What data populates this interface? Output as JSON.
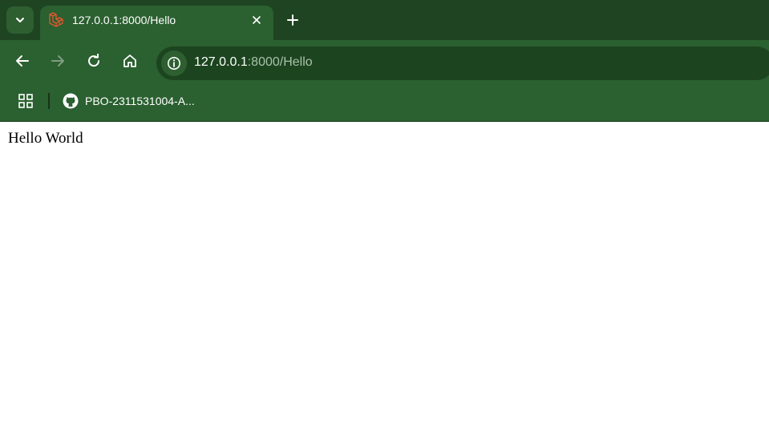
{
  "tab": {
    "title": "127.0.0.1:8000/Hello",
    "favicon": "laravel-icon"
  },
  "toolbar": {
    "url_host": "127.0.0.1",
    "url_rest": ":8000/Hello"
  },
  "bookmarks": {
    "items": [
      {
        "label": "PBO-2311531004-A...",
        "icon": "github-icon"
      }
    ]
  },
  "page": {
    "text": "Hello World"
  },
  "colors": {
    "tabstrip": "#1f4421",
    "toolbar": "#2b6030",
    "omnibox": "#1c451f",
    "favicon": "#e4572e"
  }
}
